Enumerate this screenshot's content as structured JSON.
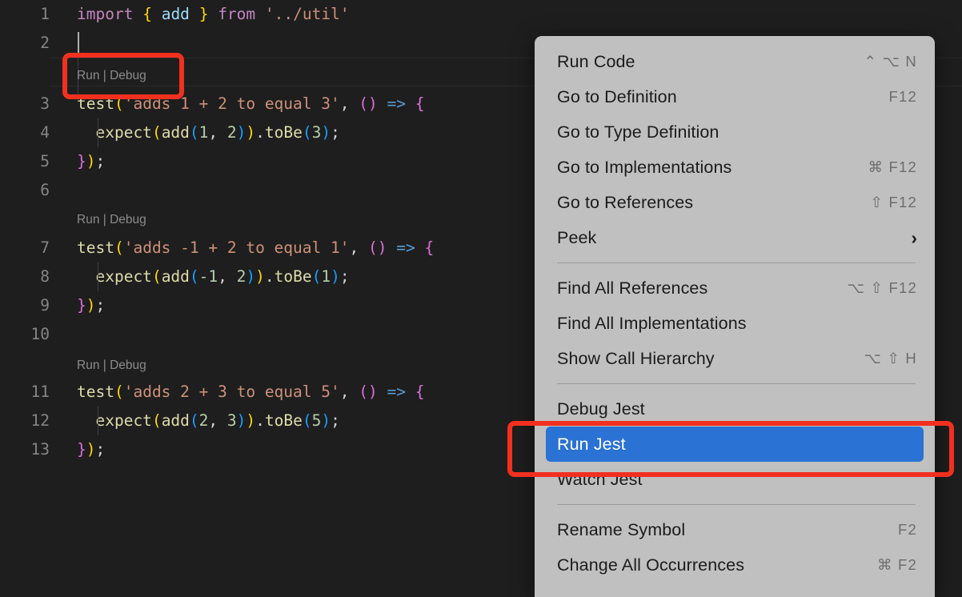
{
  "editor": {
    "language": "javascript",
    "theme": "dark",
    "lens_label": "Run | Debug",
    "lines": [
      {
        "num": "1",
        "text": "import { add } from '../util'"
      },
      {
        "num": "2",
        "text": ""
      },
      {
        "num": "3",
        "text": "test('adds 1 + 2 to equal 3', () => {"
      },
      {
        "num": "4",
        "text": "  expect(add(1, 2)).toBe(3);"
      },
      {
        "num": "5",
        "text": "});"
      },
      {
        "num": "6",
        "text": ""
      },
      {
        "num": "7",
        "text": "test('adds -1 + 2 to equal 1', () => {"
      },
      {
        "num": "8",
        "text": "  expect(add(-1, 2)).toBe(1);"
      },
      {
        "num": "9",
        "text": "});"
      },
      {
        "num": "10",
        "text": ""
      },
      {
        "num": "11",
        "text": "test('adds 2 + 3 to equal 5', () => {"
      },
      {
        "num": "12",
        "text": "  expect(add(2, 3)).toBe(5);"
      },
      {
        "num": "13",
        "text": "});"
      }
    ]
  },
  "context_menu": {
    "items": [
      {
        "label": "Run Code",
        "shortcut": "⌃ ⌥ N",
        "type": "item"
      },
      {
        "label": "Go to Definition",
        "shortcut": "F12",
        "type": "item"
      },
      {
        "label": "Go to Type Definition",
        "shortcut": "",
        "type": "item"
      },
      {
        "label": "Go to Implementations",
        "shortcut": "⌘ F12",
        "type": "item"
      },
      {
        "label": "Go to References",
        "shortcut": "⇧ F12",
        "type": "item"
      },
      {
        "label": "Peek",
        "shortcut": "",
        "type": "submenu"
      },
      {
        "type": "separator"
      },
      {
        "label": "Find All References",
        "shortcut": "⌥ ⇧ F12",
        "type": "item"
      },
      {
        "label": "Find All Implementations",
        "shortcut": "",
        "type": "item"
      },
      {
        "label": "Show Call Hierarchy",
        "shortcut": "⌥ ⇧ H",
        "type": "item"
      },
      {
        "type": "separator"
      },
      {
        "label": "Debug Jest",
        "shortcut": "",
        "type": "item"
      },
      {
        "label": "Run Jest",
        "shortcut": "",
        "type": "item",
        "selected": true
      },
      {
        "label": "Watch Jest",
        "shortcut": "",
        "type": "item"
      },
      {
        "type": "separator"
      },
      {
        "label": "Rename Symbol",
        "shortcut": "F2",
        "type": "item"
      },
      {
        "label": "Change All Occurrences",
        "shortcut": "⌘ F2",
        "type": "item"
      }
    ],
    "submenu_icon": "chevron-right-icon"
  },
  "annotations": [
    {
      "name": "codelens-highlight",
      "target": "Run | Debug",
      "color": "#f2301f"
    },
    {
      "name": "run-jest-highlight",
      "target": "Run Jest",
      "color": "#f2301f"
    }
  ],
  "colors": {
    "editor_background": "#1e1e1e",
    "menu_background": "#c0c0c0",
    "selection_blue": "#2a72d4",
    "annotation_red": "#f2301f",
    "line_number": "#858585",
    "codelens_text": "#8b8b8b"
  }
}
